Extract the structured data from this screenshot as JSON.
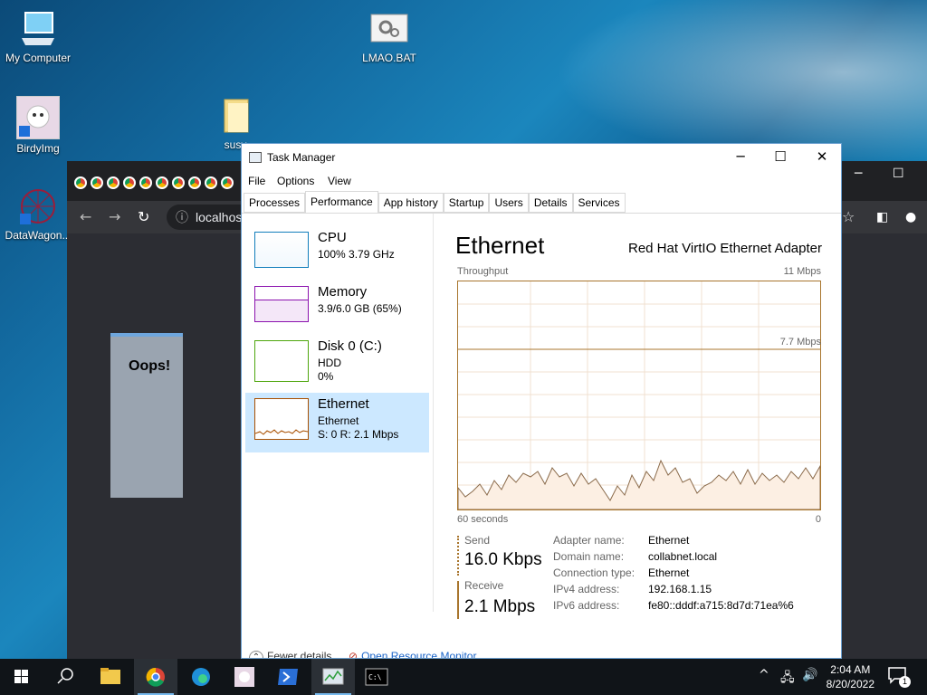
{
  "desktop": {
    "icons": [
      {
        "label": "My Computer"
      },
      {
        "label": "LMAO.BAT"
      },
      {
        "label": "BirdyImg"
      },
      {
        "label": "susy"
      },
      {
        "label": "DataWagon..."
      }
    ]
  },
  "browser": {
    "address_text": "localhos",
    "dialog_text": "Oops!"
  },
  "task_manager": {
    "title": "Task Manager",
    "menu": [
      "File",
      "Options",
      "View"
    ],
    "tabs": [
      "Processes",
      "Performance",
      "App history",
      "Startup",
      "Users",
      "Details",
      "Services"
    ],
    "active_tab": "Performance",
    "sidebar": [
      {
        "name": "CPU",
        "line1": "100%  3.79 GHz",
        "line2": "",
        "color": "#117dbb"
      },
      {
        "name": "Memory",
        "line1": "3.9/6.0 GB (65%)",
        "line2": "",
        "color": "#8b12ae"
      },
      {
        "name": "Disk 0 (C:)",
        "line1": "HDD",
        "line2": "0%",
        "color": "#4da60c"
      },
      {
        "name": "Ethernet",
        "line1": "Ethernet",
        "line2": "S: 0  R: 2.1 Mbps",
        "color": "#a74f01"
      }
    ],
    "detail": {
      "title": "Ethernet",
      "adapter": "Red Hat VirtIO Ethernet Adapter",
      "throughput_label": "Throughput",
      "max_label": "11 Mbps",
      "mid_label": "7.7 Mbps",
      "time_left": "60 seconds",
      "time_right": "0",
      "send_label": "Send",
      "send_value": "16.0 Kbps",
      "receive_label": "Receive",
      "receive_value": "2.1 Mbps",
      "props": [
        {
          "k": "Adapter name:",
          "v": "Ethernet"
        },
        {
          "k": "Domain name:",
          "v": "collabnet.local"
        },
        {
          "k": "Connection type:",
          "v": "Ethernet"
        },
        {
          "k": "IPv4 address:",
          "v": "192.168.1.15"
        },
        {
          "k": "IPv6 address:",
          "v": "fe80::dddf:a715:8d7d:71ea%6"
        }
      ]
    },
    "footer": {
      "fewer": "Fewer details",
      "monitor": "Open Resource Monitor"
    }
  },
  "taskbar": {
    "time": "2:04 AM",
    "date": "8/20/2022",
    "notifications": "1"
  }
}
